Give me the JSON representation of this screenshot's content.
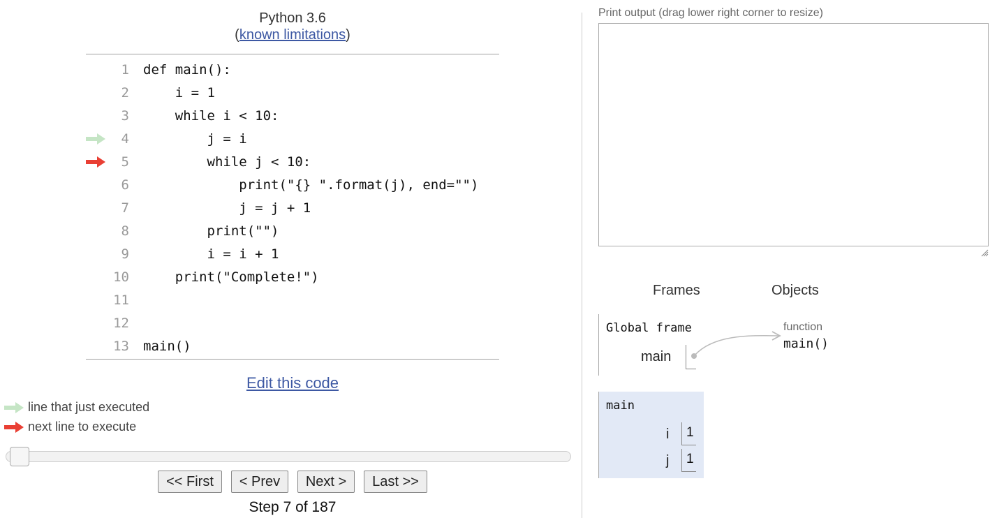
{
  "header": {
    "language": "Python 3.6",
    "limits_open": "(",
    "limits_link": "known limitations",
    "limits_close": ")"
  },
  "code": {
    "lines": [
      {
        "num": "1",
        "text": "def main():"
      },
      {
        "num": "2",
        "text": "    i = 1"
      },
      {
        "num": "3",
        "text": "    while i < 10:"
      },
      {
        "num": "4",
        "text": "        j = i"
      },
      {
        "num": "5",
        "text": "        while j < 10:"
      },
      {
        "num": "6",
        "text": "            print(\"{} \".format(j), end=\"\")"
      },
      {
        "num": "7",
        "text": "            j = j + 1"
      },
      {
        "num": "8",
        "text": "        print(\"\")"
      },
      {
        "num": "9",
        "text": "        i = i + 1"
      },
      {
        "num": "10",
        "text": "    print(\"Complete!\")"
      },
      {
        "num": "11",
        "text": ""
      },
      {
        "num": "12",
        "text": ""
      },
      {
        "num": "13",
        "text": "main()"
      }
    ],
    "just_executed_line": 4,
    "next_line": 5
  },
  "edit_link": "Edit this code",
  "legend": {
    "just_executed": "line that just executed",
    "next": "next line to execute"
  },
  "controls": {
    "first": "<< First",
    "prev": "< Prev",
    "next": "Next >",
    "last": "Last >>",
    "step_text": "Step 7 of 187",
    "step_current": 7,
    "step_total": 187
  },
  "output": {
    "label": "Print output (drag lower right corner to resize)",
    "text": ""
  },
  "viz": {
    "frames_header": "Frames",
    "objects_header": "Objects",
    "global_frame": {
      "title": "Global frame",
      "var": "main"
    },
    "function_object": {
      "type_label": "function",
      "value": "main()"
    },
    "main_frame": {
      "title": "main",
      "vars": [
        {
          "name": "i",
          "value": "1"
        },
        {
          "name": "j",
          "value": "1"
        }
      ]
    }
  },
  "colors": {
    "just_executed_arrow": "#c5e5c5",
    "next_arrow": "#e93f34",
    "frame_bg": "#e2e9f6",
    "link": "#3d58a3"
  }
}
